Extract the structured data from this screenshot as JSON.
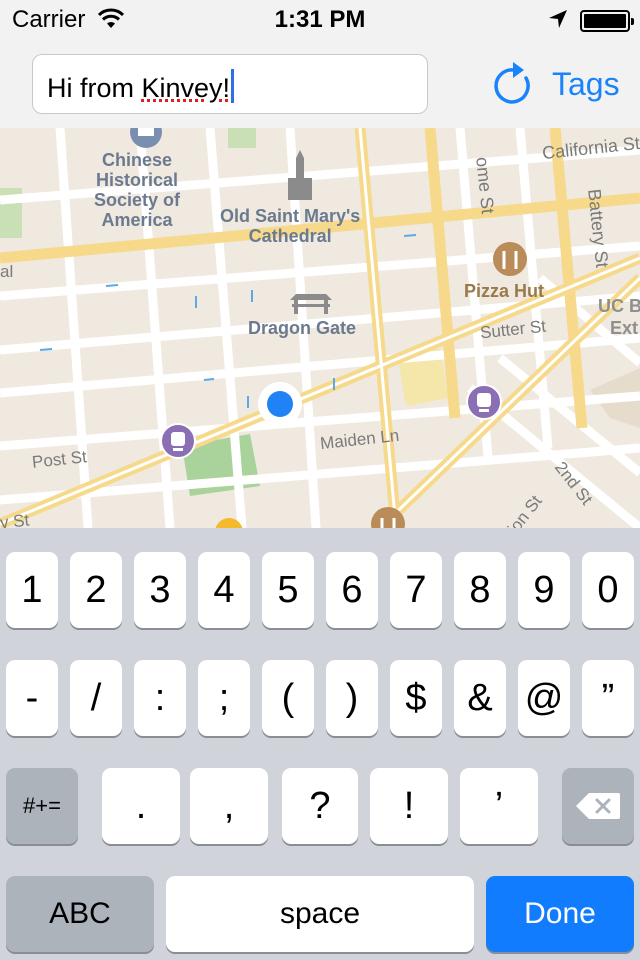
{
  "status_bar": {
    "carrier": "Carrier",
    "time": "1:31 PM"
  },
  "top_bar": {
    "text_field": {
      "prefix": "Hi from ",
      "misspelled_word": "Kinvey!"
    },
    "tags_label": "Tags",
    "accent_color": "#1a82fb"
  },
  "map": {
    "labels": {
      "chinese_historical": "Chinese\nHistorical\nSociety of\nAmerica",
      "old_saint_marys": "Old Saint Mary's\nCathedral",
      "dragon_gate": "Dragon Gate",
      "pizza_hut": "Pizza Hut",
      "california_st": "California St",
      "stockton_st": "ome St",
      "battery_st": "Battery St",
      "sutter_st": "Sutter St",
      "uc_berkeley": "UC B",
      "uc_ext": "Ext",
      "post_st": "Post St",
      "maiden_ln": "Maiden Ln",
      "second_st": "2nd St",
      "market_st": "ion St",
      "left_edge": "al",
      "bottom_left": "y St"
    }
  },
  "keyboard": {
    "row1": [
      "1",
      "2",
      "3",
      "4",
      "5",
      "6",
      "7",
      "8",
      "9",
      "0"
    ],
    "row2": [
      "-",
      "/",
      ":",
      ";",
      "(",
      ")",
      "$",
      "&",
      "@",
      "”"
    ],
    "row3": [
      ".",
      ",",
      "?",
      "!",
      "’"
    ],
    "symbols_key": "#+=",
    "abc_key": "ABC",
    "space_key": "space",
    "done_key": "Done"
  }
}
